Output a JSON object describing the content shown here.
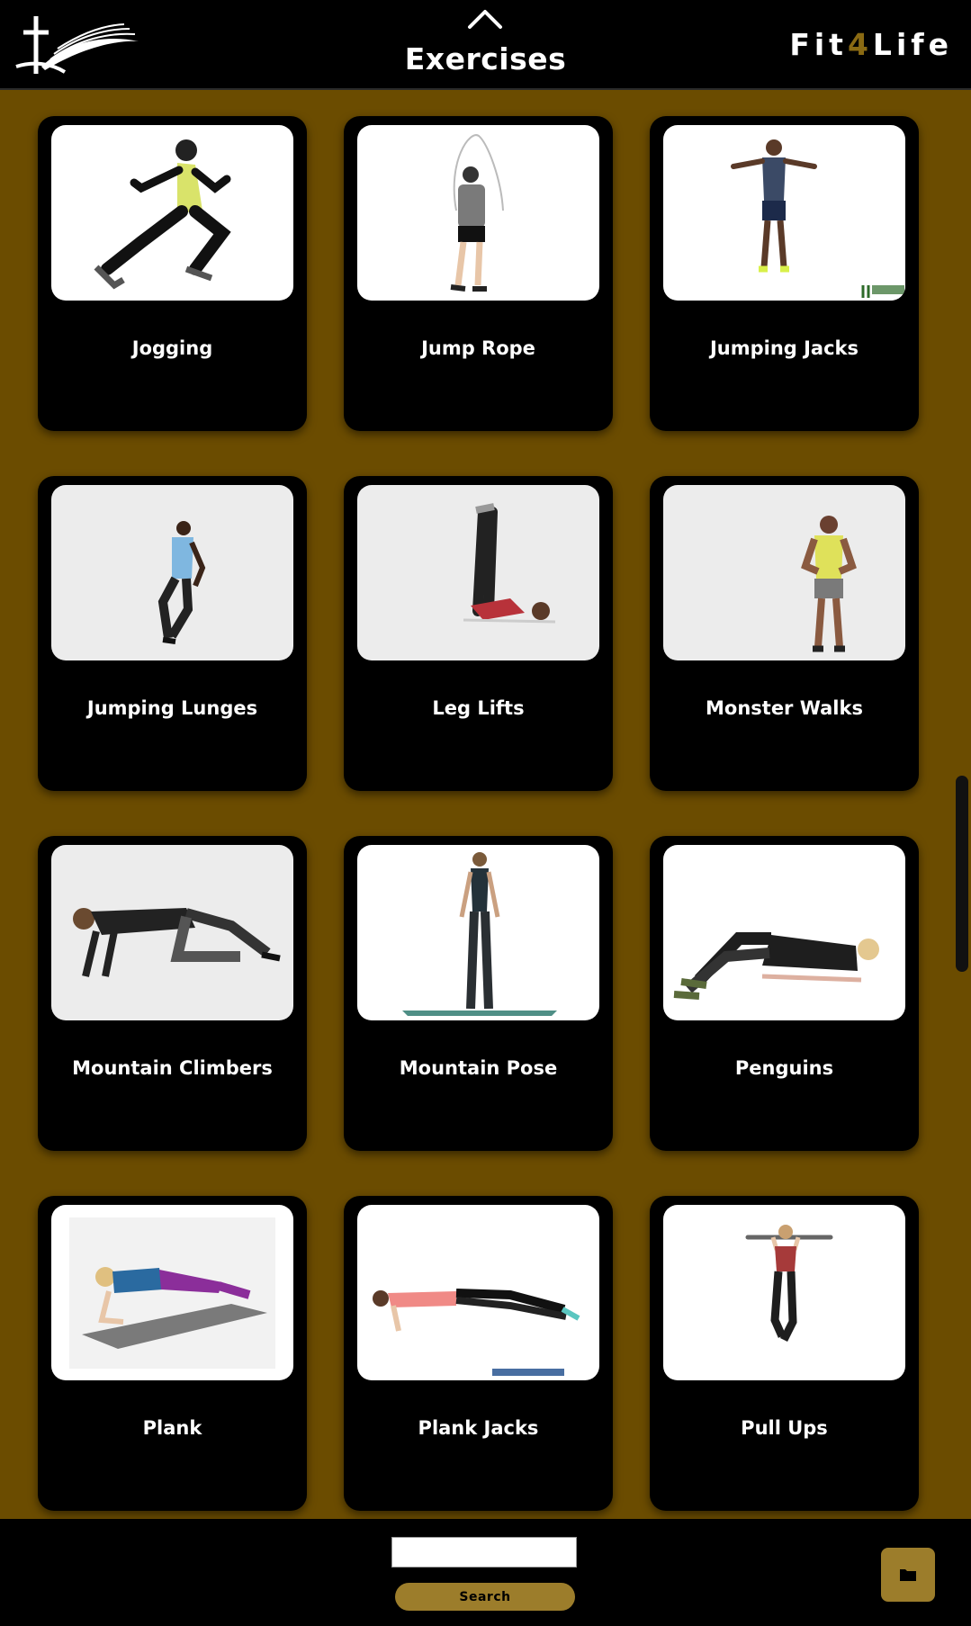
{
  "header": {
    "title": "Exercises",
    "brand_prefix": "Fit",
    "brand_accent": "4",
    "brand_suffix": "Life",
    "accent_color": "#8a6a13"
  },
  "exercises": [
    {
      "label": "Jogging"
    },
    {
      "label": "Jump Rope"
    },
    {
      "label": "Jumping Jacks"
    },
    {
      "label": "Jumping Lunges"
    },
    {
      "label": "Leg Lifts"
    },
    {
      "label": "Monster Walks"
    },
    {
      "label": "Mountain Climbers"
    },
    {
      "label": "Mountain Pose"
    },
    {
      "label": "Penguins"
    },
    {
      "label": "Plank"
    },
    {
      "label": "Plank Jacks"
    },
    {
      "label": "Pull Ups"
    }
  ],
  "search": {
    "value": "",
    "placeholder": "",
    "button_label": "Search"
  },
  "colors": {
    "background": "#6b4c00",
    "bar": "#000000",
    "gold_button": "#9c7d2b"
  },
  "icons": {
    "logo": "cross-book-logo",
    "collapse": "chevron-up-icon",
    "folder": "folder-icon"
  }
}
